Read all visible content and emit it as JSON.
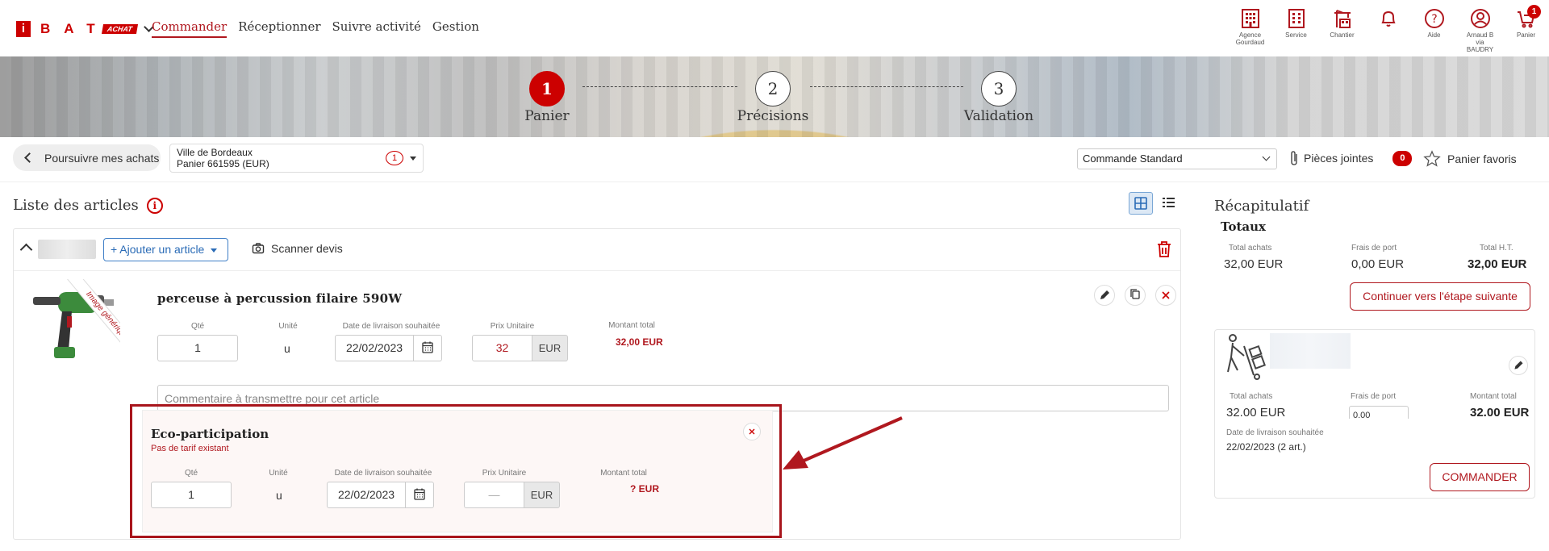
{
  "nav": {
    "logo_letters": "BAT",
    "logo_achat": "ACHAT",
    "items": [
      "Commander",
      "Réceptionner",
      "Suivre activité",
      "Gestion"
    ]
  },
  "toolbar_icons": [
    {
      "icon": "building-icon",
      "label": "Agence Gourdaud"
    },
    {
      "icon": "building-icon",
      "label": "Service"
    },
    {
      "icon": "crane-icon",
      "label": "Chantier"
    },
    {
      "icon": "bell-icon",
      "label": ""
    },
    {
      "icon": "help-icon",
      "label": "Aide"
    },
    {
      "icon": "user-icon",
      "label": "Arnaud B via BAUDRY"
    },
    {
      "icon": "cart-icon",
      "label": "Panier",
      "badge": "1"
    }
  ],
  "steps": [
    {
      "num": "1",
      "label": "Panier"
    },
    {
      "num": "2",
      "label": "Précisions"
    },
    {
      "num": "3",
      "label": "Validation"
    }
  ],
  "actions": {
    "back_label": "Poursuivre mes achats",
    "cart_line1": "Ville de Bordeaux",
    "cart_line2": "Panier 661595 (EUR)",
    "cart_count": "1",
    "order_type": "Commande Standard",
    "attachments_label": "Pièces jointes",
    "attachments_count": "0",
    "favorites_label": "Panier favoris"
  },
  "list": {
    "title": "Liste des articles",
    "add_article": "+ Ajouter un article",
    "scan_quote": "Scanner devis"
  },
  "article": {
    "ribbon": "Image générique",
    "name": "perceuse à percussion filaire 590W",
    "labels": {
      "qty": "Qté",
      "unit": "Unité",
      "date": "Date de livraison souhaitée",
      "price": "Prix Unitaire",
      "total": "Montant total"
    },
    "qty": "1",
    "unit": "u",
    "date": "22/02/2023",
    "price": "32",
    "currency": "EUR",
    "total": "32,00 EUR",
    "comment_placeholder": "Commentaire à transmettre pour cet article"
  },
  "eco": {
    "title": "Eco-participation",
    "subtitle": "Pas de tarif existant",
    "labels": {
      "qty": "Qté",
      "unit": "Unité",
      "date": "Date de livraison souhaitée",
      "price": "Prix Unitaire",
      "total": "Montant total"
    },
    "qty": "1",
    "unit": "u",
    "date": "22/02/2023",
    "price": "—",
    "currency": "EUR",
    "total": "? EUR"
  },
  "recap": {
    "title": "Récapitulatif",
    "totals_title": "Totaux",
    "total_achats_label": "Total achats",
    "total_achats": "32,00 EUR",
    "frais_label": "Frais de port",
    "frais": "0,00 EUR",
    "total_ht_label": "Total H.T.",
    "total_ht": "32,00 EUR",
    "next_button": "Continuer vers l'étape suivante"
  },
  "supplier": {
    "total_achats_label": "Total achats",
    "total_achats": "32.00 EUR",
    "frais_label": "Frais de port",
    "frais": "0.00",
    "montant_label": "Montant total",
    "montant": "32.00 EUR",
    "date_label": "Date de livraison souhaitée",
    "date": "22/02/2023 (2 art.)",
    "order_button": "COMMANDER"
  },
  "colors": {
    "brand": "#c00000",
    "accent_blue": "#2a6bb6",
    "highlight_border": "#a8151c"
  }
}
